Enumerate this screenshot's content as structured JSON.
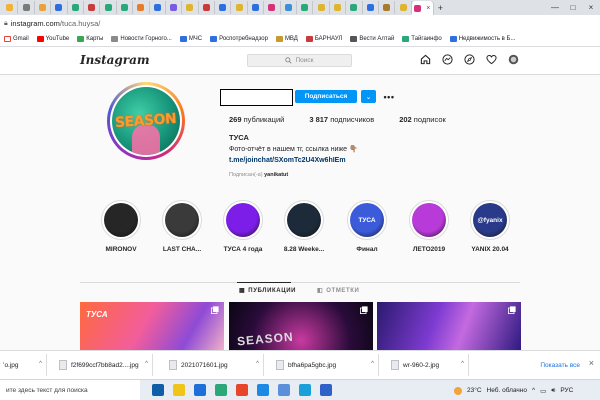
{
  "browser": {
    "tab_favicons": [
      "#f2b233",
      "#7a7a7a",
      "#e8a33a",
      "#2e6fe0",
      "#2ba87a",
      "#c93b3b",
      "#2ba87a",
      "#2ba87a",
      "#e57c2b",
      "#2e6fe0",
      "#7a5ae0",
      "#e0b52e",
      "#c93b3b",
      "#2e6fe0",
      "#e0b52e",
      "#2e6fe0",
      "#d6307a",
      "#3a8fd9",
      "#2ba87a",
      "#e0b52e",
      "#e0b52e",
      "#2ba87a",
      "#2e6fe0",
      "#a77a2e",
      "#e0b52e"
    ],
    "active_tab_close": "×",
    "add_tab": "+",
    "window_controls": [
      "—",
      "□",
      "×"
    ],
    "address": {
      "host": "instagram.com",
      "path": "/tuca.huysa/"
    },
    "bookmarks": [
      {
        "label": "Gmail",
        "color": "#ffffff"
      },
      {
        "label": "YouTube",
        "color": "#ff0000"
      },
      {
        "label": "Карты",
        "color": "#34a853"
      },
      {
        "label": "Новости Горного...",
        "color": "#8a8a8a"
      },
      {
        "label": "МЧС",
        "color": "#2e6fe0"
      },
      {
        "label": "Роспотребнадзор",
        "color": "#2e6fe0"
      },
      {
        "label": "МВД",
        "color": "#c89a2e"
      },
      {
        "label": "БАРНАУЛ",
        "color": "#c93b3b"
      },
      {
        "label": "Вести Алтай",
        "color": "#555555"
      },
      {
        "label": "Тайгаинфо",
        "color": "#2ba87a"
      },
      {
        "label": "Недвижимость в Б...",
        "color": "#2e6fe0"
      }
    ]
  },
  "header": {
    "logo": "Instagram",
    "search_placeholder": "Поиск",
    "search_icon": "🔍"
  },
  "profile": {
    "avatar_text": "SEASON",
    "follow_label": "Подписаться",
    "dropdown_glyph": "⌄",
    "more_glyph": "•••",
    "stats": [
      {
        "num": "269",
        "label": "публикаций"
      },
      {
        "num": "3 817",
        "label": "подписчиков"
      },
      {
        "num": "202",
        "label": "подписок"
      }
    ],
    "name": "ТУСА",
    "bio": "Фото-отчёт в нашем тг, ссылка ниже 👇🏽",
    "link": "t.me/joinchat/SXomTc2U4Xw6hIEm",
    "followed_by_prefix": "Подписан(-а)",
    "followed_by_user": "yanikatut"
  },
  "highlights": [
    {
      "label": "MIRONOV",
      "color": "#262626",
      "text": ""
    },
    {
      "label": "LAST CHA...",
      "color": "#3a3a3a",
      "text": ""
    },
    {
      "label": "ТУСА 4 года",
      "color": "#7d1ee8",
      "text": ""
    },
    {
      "label": "8.28 Weeke...",
      "color": "#1d2a3a",
      "text": ""
    },
    {
      "label": "Финал",
      "color": "#3b5bdb",
      "text": "ТУСА"
    },
    {
      "label": "ЛЕТО2019",
      "color": "#b83ad9",
      "text": ""
    },
    {
      "label": "YANIX 20.04",
      "color": "#2a3a8a",
      "text": "@fyanix"
    }
  ],
  "tabs": [
    {
      "label": "ПУБЛИКАЦИИ",
      "icon": "▦",
      "active": true
    },
    {
      "label": "ОТМЕТКИ",
      "icon": "◧",
      "active": false
    }
  ],
  "posts": [
    {
      "title": "ТУСА"
    },
    {
      "title": "SEASON"
    },
    {
      "title": ""
    }
  ],
  "downloads": {
    "items": [
      {
        "name": "ʼo.jpg"
      },
      {
        "name": "f2f699ccf7bb8ad2....jpg"
      },
      {
        "name": "2021071601.jpg"
      },
      {
        "name": "bfha6pa5gbc.jpg"
      },
      {
        "name": "wr-960-2.jpg"
      }
    ],
    "show_all": "Показать все",
    "close_glyph": "×"
  },
  "taskbar": {
    "search_placeholder": "ите здесь текст для поиска",
    "apps": [
      "#0f5ea8",
      "#f0c419",
      "#1f6fd9",
      "#2ba87a",
      "#e8462a",
      "#1e88e5",
      "#5b8fd9",
      "#1aa0d8",
      "#2e62c9"
    ],
    "temperature": "23°C",
    "weather": "Неб. облачно",
    "lang": "РУС"
  }
}
